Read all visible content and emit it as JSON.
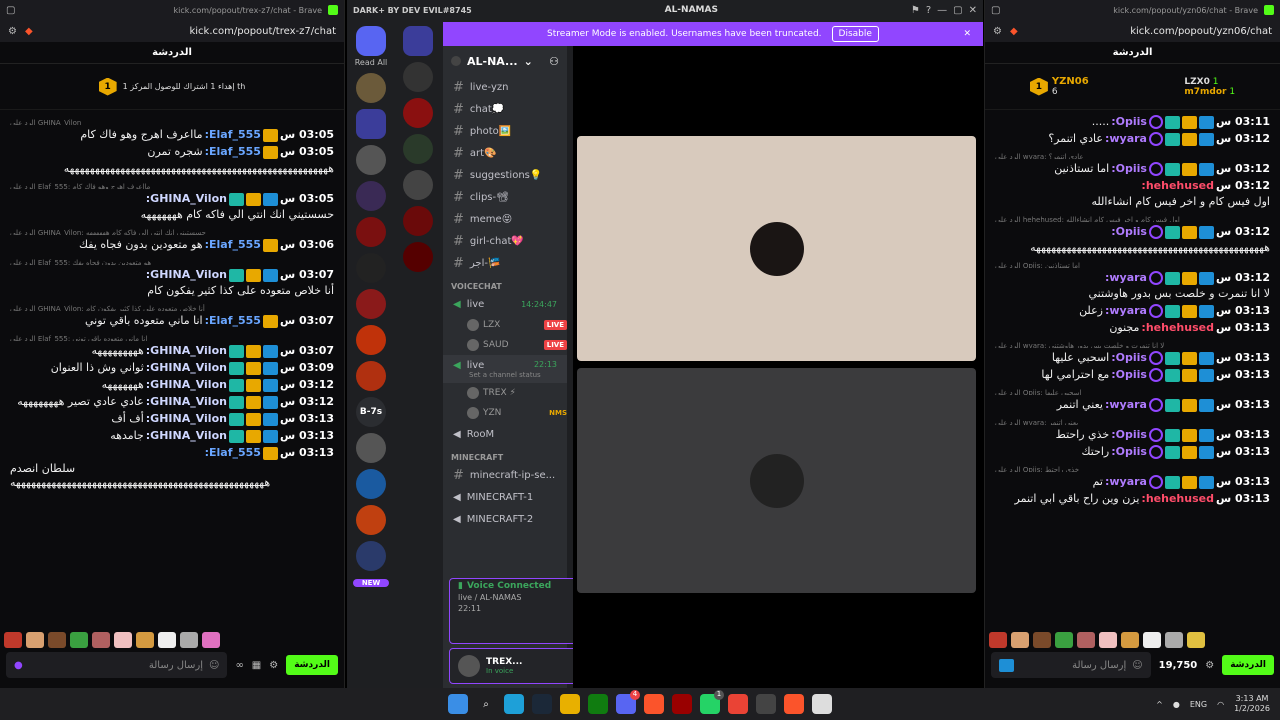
{
  "left": {
    "tabtitle": "kick.com/popout/trex-z7/chat - Brave",
    "url": "kick.com/popout/trex-z7/chat",
    "chat_title": "الدردشة",
    "pinned": {
      "num": "1",
      "text": "إهداء 1 اشتراك للوصول المركز 1 th"
    },
    "messages": [
      {
        "reply": "الرد على GHINA_Vilon",
        "ts": "03:05 س",
        "name": "Elaf_555:",
        "cls": "name-blue",
        "badges": [
          "crown"
        ],
        "text": "مااعرف اهرج وهو فاك كام"
      },
      {
        "reply": "",
        "ts": "03:05 س",
        "name": "Elaf_555:",
        "cls": "name-blue",
        "badges": [
          "crown"
        ],
        "text": "شجره تمرن"
      },
      {
        "reply": "",
        "ts": "",
        "name": "",
        "cls": "",
        "badges": [],
        "text": "ههههههههههههههههههههههههههههههههههههههههههههههههههههه"
      },
      {
        "reply": "الرد على Elaf_555: مااعرف اهرج وهو فاك كام",
        "ts": "03:05 س",
        "name": "GHINA_Vilon:",
        "cls": "name-green",
        "badges": [
          "hammer",
          "crown",
          "sub"
        ],
        "text": "حسستيني انك انتي الي فاكه كام هههههههه"
      },
      {
        "reply": "الرد على GHINA_Vilon: حسستيني انك انتي الي فاكه كام ههههههه",
        "ts": "03:06 س",
        "name": "Elaf_555:",
        "cls": "name-blue",
        "badges": [
          "crown"
        ],
        "text": "هو متعودين بدون فجاه يفك"
      },
      {
        "reply": "الرد على Elaf_555: هو متعودين بدون فجاه يفك",
        "ts": "03:07 س",
        "name": "GHINA_Vilon:",
        "cls": "name-green",
        "badges": [
          "hammer",
          "crown",
          "sub"
        ],
        "text": "أنا خلاص متعوده على كذا كثير يفكون كام"
      },
      {
        "reply": "الرد على GHINA_Vilon: أنا خلاص متعوده على كذا كثير يفكون كام",
        "ts": "03:07 س",
        "name": "Elaf_555:",
        "cls": "name-blue",
        "badges": [
          "crown"
        ],
        "text": "انا ماني متعوده باقي توني"
      },
      {
        "reply": "الرد على Elaf_555: انا ماني متعوده باقي توني",
        "ts": "03:07 س",
        "name": "GHINA_Vilon:",
        "cls": "name-green",
        "badges": [
          "hammer",
          "crown",
          "sub"
        ],
        "text": "هههههههههه"
      },
      {
        "reply": "",
        "ts": "03:09 س",
        "name": "GHINA_Vilon:",
        "cls": "name-green",
        "badges": [
          "hammer",
          "crown",
          "sub"
        ],
        "text": "ثواني وش ذا العنوان"
      },
      {
        "reply": "",
        "ts": "03:12 س",
        "name": "GHINA_Vilon:",
        "cls": "name-green",
        "badges": [
          "hammer",
          "crown",
          "sub"
        ],
        "text": "هههههههه"
      },
      {
        "reply": "",
        "ts": "03:12 س",
        "name": "GHINA_Vilon:",
        "cls": "name-green",
        "badges": [
          "hammer",
          "crown",
          "sub"
        ],
        "text": "عادي عادي تصير ههههههههه"
      },
      {
        "reply": "",
        "ts": "03:13 س",
        "name": "GHINA_Vilon:",
        "cls": "name-green",
        "badges": [
          "hammer",
          "crown",
          "sub"
        ],
        "text": "أف أف"
      },
      {
        "reply": "",
        "ts": "03:13 س",
        "name": "GHINA_Vilon:",
        "cls": "name-green",
        "badges": [
          "hammer",
          "crown",
          "sub"
        ],
        "text": "جامدهه"
      },
      {
        "reply": "",
        "ts": "03:13 س",
        "name": "Elaf_555:",
        "cls": "name-blue",
        "badges": [
          "crown"
        ],
        "text": "سلطان انصدم ههههههههههههههههههههههههههههههههههههههههههههههههههه"
      }
    ],
    "input_placeholder": "إرسال رسالة",
    "send": "الدردشة"
  },
  "discord": {
    "title_left": "DARK+ BY DEV EVIL#8745",
    "title_center": "AL-NAMAS",
    "banner": "Streamer Mode is enabled. Usernames have been truncated.",
    "banner_btn": "Disable",
    "read_all": "Read All",
    "server_name": "AL-NA...",
    "text_channels": [
      "live-yzn",
      "chat💭",
      "photo🖼️",
      "art🎨",
      "suggestions💡",
      "clips-📽",
      "meme😝",
      "girl-chat💖",
      "اجر-🎏"
    ],
    "voice_cat": "VOICECHAT",
    "voice1": {
      "name": "live",
      "time": "14:24:47",
      "users": [
        {
          "n": "LZX",
          "l": "LIVE"
        },
        {
          "n": "SAUD",
          "l": "LIVE"
        }
      ]
    },
    "voice2": {
      "name": "live",
      "time": "22:13",
      "status": "Set a channel status",
      "users": [
        {
          "n": "TREX ⚡",
          "l": ""
        },
        {
          "n": "YZN",
          "l": "NMS"
        }
      ]
    },
    "room": "RooM",
    "mc_cat": "MINECRAFT",
    "mc": [
      "minecraft-ip-se...",
      "MINECRAFT-1",
      "MINECRAFT-2"
    ],
    "vc_title": "Voice Connected",
    "vc_sub": "live / AL-NAMAS",
    "vc_time": "22:11",
    "user_name": "TREX...",
    "user_status": "In voice",
    "new": "NEW",
    "b7s": "B-7s"
  },
  "right": {
    "tabtitle": "kick.com/popout/yzn06/chat - Brave",
    "url": "kick.com/popout/yzn06/chat",
    "chat_title": "الدردشة",
    "leader": {
      "name": "YZN06",
      "n1": "1",
      "n2": "6",
      "top1": "LZX0",
      "top1c": "1",
      "top2": "m7mdor",
      "top2c": "1"
    },
    "messages": [
      {
        "reply": "",
        "ts": "03:11 س",
        "name": "Opiis:",
        "cls": "name-purple",
        "badges": [
          "hammer",
          "crown",
          "sub",
          "circ"
        ],
        "text": "....."
      },
      {
        "reply": "",
        "ts": "03:12 س",
        "name": "wyara:",
        "cls": "name-purple",
        "badges": [
          "hammer",
          "crown",
          "sub",
          "circ"
        ],
        "text": "عادي اتنمر؟"
      },
      {
        "reply": "الرد على wyara: عادي اتنمر؟",
        "ts": "03:12 س",
        "name": "Opiis:",
        "cls": "name-purple",
        "badges": [
          "hammer",
          "crown",
          "sub",
          "circ"
        ],
        "text": "اما تستاذنين"
      },
      {
        "reply": "",
        "ts": "03:12 س",
        "name": "hehehused:",
        "cls": "name-red",
        "badges": [],
        "text": "اول فيس كام و اخر فيس كام انشاءالله"
      },
      {
        "reply": "الرد على hehehused: اول فيس كام و اخر فيس كام انشاءالله",
        "ts": "03:12 س",
        "name": "Opiis:",
        "cls": "name-purple",
        "badges": [
          "hammer",
          "crown",
          "sub",
          "circ"
        ],
        "text": "ههههههههههههههههههههههههههههههههههههههههههههههه"
      },
      {
        "reply": "الرد على Opiis: اما تستاذنين",
        "ts": "03:12 س",
        "name": "wyara:",
        "cls": "name-purple",
        "badges": [
          "hammer",
          "crown",
          "sub",
          "circ"
        ],
        "text": "لا انا تنمرت و خلصت بس بدور هاوشتني"
      },
      {
        "reply": "",
        "ts": "03:13 س",
        "name": "wyara:",
        "cls": "name-purple",
        "badges": [
          "hammer",
          "crown",
          "sub",
          "circ"
        ],
        "text": "زعلن"
      },
      {
        "reply": "",
        "ts": "03:13 س",
        "name": "hehehused:",
        "cls": "name-red",
        "badges": [],
        "text": "مجنون"
      },
      {
        "reply": "الرد على wyara: لا انا تنمرت و خلصت بس بدور هاوشتني",
        "ts": "03:13 س",
        "name": "Opiis:",
        "cls": "name-purple",
        "badges": [
          "hammer",
          "crown",
          "sub",
          "circ"
        ],
        "text": "اسحبي عليها"
      },
      {
        "reply": "",
        "ts": "03:13 س",
        "name": "Opiis:",
        "cls": "name-purple",
        "badges": [
          "hammer",
          "crown",
          "sub",
          "circ"
        ],
        "text": "مع احترامي لها"
      },
      {
        "reply": "الرد على Opiis: اسحبي عليها",
        "ts": "03:13 س",
        "name": "wyara:",
        "cls": "name-purple",
        "badges": [
          "hammer",
          "crown",
          "sub",
          "circ"
        ],
        "text": "يعني اتنمر"
      },
      {
        "reply": "الرد على wyara: يعني اتنمر",
        "ts": "03:13 س",
        "name": "Opiis:",
        "cls": "name-purple",
        "badges": [
          "hammer",
          "crown",
          "sub",
          "circ"
        ],
        "text": "خذي راحتط"
      },
      {
        "reply": "",
        "ts": "03:13 س",
        "name": "Opiis:",
        "cls": "name-purple",
        "badges": [
          "hammer",
          "crown",
          "sub",
          "circ"
        ],
        "text": "راحتك"
      },
      {
        "reply": "الرد على Opiis: خذي راحتط",
        "ts": "03:13 س",
        "name": "wyara:",
        "cls": "name-purple",
        "badges": [
          "hammer",
          "crown",
          "sub",
          "circ"
        ],
        "text": "تم"
      },
      {
        "reply": "",
        "ts": "03:13 س",
        "name": "hehehused:",
        "cls": "name-red",
        "badges": [],
        "text": "يزن وين راح باقي ابي اتنمر"
      }
    ],
    "input_placeholder": "إرسال رسالة",
    "points": "19,750",
    "send": "الدردشة"
  },
  "taskbar": {
    "lang": "ENG",
    "time": "3:13 AM",
    "date": "1/2/2026",
    "discord_badge": "4",
    "whatsapp_badge": "1"
  }
}
